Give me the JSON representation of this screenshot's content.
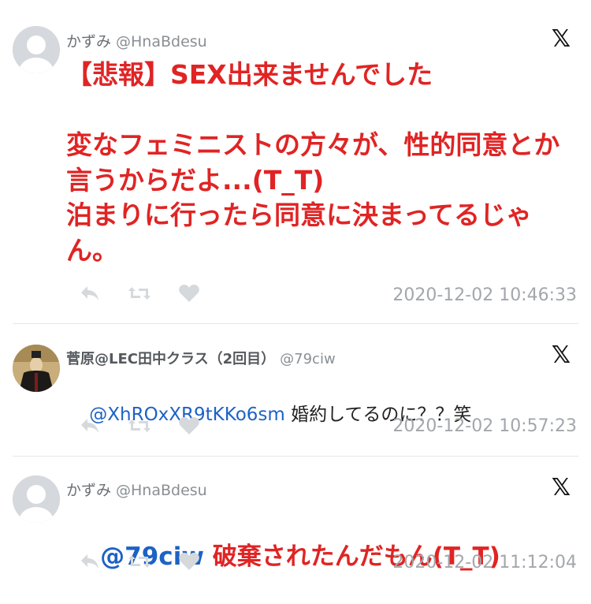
{
  "tweets": [
    {
      "name": "かずみ",
      "handle": "@HnaBdesu",
      "body_lines": "【悲報】SEX出来ませんでした\n\n変なフェミニストの方々が、性的同意とか言うからだよ...(T_T)\n泊まりに行ったら同意に決まってるじゃん。",
      "timestamp": "2020-12-02 10:46:33"
    },
    {
      "name": "菅原@LEC田中クラス（2回目）",
      "handle": "@79ciw",
      "mention": "@XhROxXR9tKKo6sm",
      "body_text": " 婚約してるのに？？笑",
      "timestamp": "2020-12-02 10:57:23"
    },
    {
      "name": "かずみ",
      "handle": "@HnaBdesu",
      "mention": "@79ciw",
      "body_text": " 破棄されたんだもん(T_T)",
      "timestamp": "2020-12-02 11:12:04"
    }
  ],
  "icons": {
    "reply": "reply-icon",
    "retweet": "retweet-icon",
    "like": "heart-icon",
    "platform": "x-logo-icon",
    "platform_glyph": "𝕏"
  },
  "colors": {
    "red_text": "#e02424",
    "mention": "#1d62c5",
    "timestamp": "#a3a7ab",
    "icon_gray": "#d6d9dc"
  }
}
